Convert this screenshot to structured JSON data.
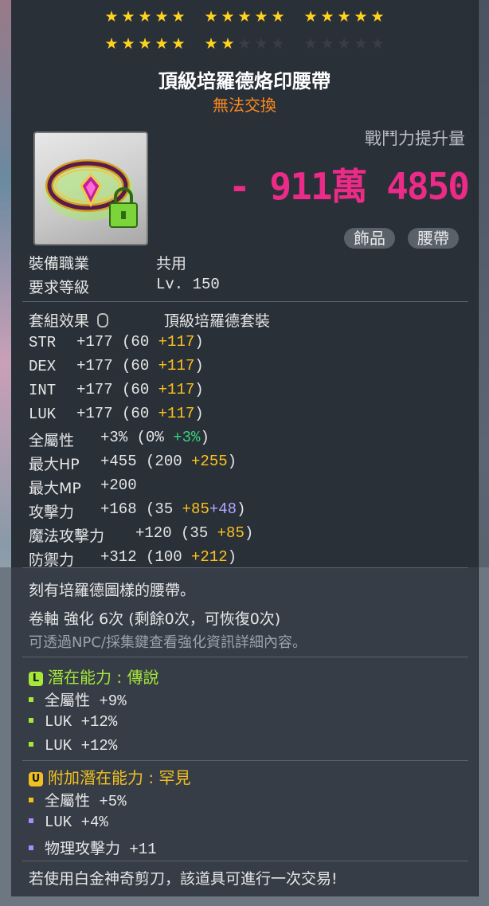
{
  "stars": {
    "row1": [
      5,
      5,
      5
    ],
    "row2": [
      5,
      2,
      0
    ],
    "per_group": 5
  },
  "item": {
    "name": "頂級培羅德烙印腰帶",
    "trade_status": "無法交換",
    "cp_label": "戰鬥力提升量",
    "cp_value": "- 911萬 4850",
    "tags": [
      "飾品",
      "腰帶"
    ]
  },
  "info": {
    "job_label": "裝備職業",
    "job_value": "共用",
    "level_label": "要求等級",
    "level_value": "Lv. 150",
    "set_label": "套組效果",
    "set_value": "頂級培羅德套裝"
  },
  "stats": [
    {
      "name": "STR",
      "total": "+177",
      "base": "(60",
      "bonus": "+117",
      "bonus2": "",
      "green": "",
      "close": ")"
    },
    {
      "name": "DEX",
      "total": "+177",
      "base": "(60",
      "bonus": "+117",
      "bonus2": "",
      "green": "",
      "close": ")"
    },
    {
      "name": "INT",
      "total": "+177",
      "base": "(60",
      "bonus": "+117",
      "bonus2": "",
      "green": "",
      "close": ")"
    },
    {
      "name": "LUK",
      "total": "+177",
      "base": "(60",
      "bonus": "+117",
      "bonus2": "",
      "green": "",
      "close": ")"
    },
    {
      "name": "全屬性",
      "total": "+3%",
      "base": "(0%",
      "bonus": "",
      "bonus2": "",
      "green": "+3%",
      "close": ")"
    },
    {
      "name": "最大HP",
      "total": "+455",
      "base": "(200",
      "bonus": "+255",
      "bonus2": "",
      "green": "",
      "close": ")"
    },
    {
      "name": "最大MP",
      "total": "+200",
      "base": "",
      "bonus": "",
      "bonus2": "",
      "green": "",
      "close": ""
    },
    {
      "name": "攻擊力",
      "total": "+168",
      "base": "(35",
      "bonus": "+85",
      "bonus2": "+48",
      "green": "",
      "close": ")"
    },
    {
      "name": "魔法攻擊力",
      "total": "+120",
      "base": "(35",
      "bonus": "+85",
      "bonus2": "",
      "green": "",
      "close": ")"
    },
    {
      "name": "防禦力",
      "total": "+312",
      "base": "(100",
      "bonus": "+212",
      "bonus2": "",
      "green": "",
      "close": ")"
    }
  ],
  "description": "刻有培羅德圖樣的腰帶。",
  "scroll": "卷軸 強化 6次 (剩餘0次，可恢復0次)",
  "hint": "可透過NPC/採集鍵查看強化資訊詳細內容。",
  "potential": {
    "badge": "L",
    "title": "潛在能力 : 傳說",
    "color": "#a6e83a",
    "lines": [
      "全屬性 +9%",
      "LUK +12%",
      "LUK +12%"
    ]
  },
  "additional": {
    "badge": "U",
    "title": "附加潛在能力 : 罕見",
    "color": "#f0c020",
    "lines": [
      {
        "text": "全屬性 +5%",
        "color": "#f0c020"
      },
      {
        "text": "LUK +4%",
        "color": "#a98cff"
      },
      {
        "text": "物理攻擊力 +11",
        "color": "#a98cff"
      }
    ]
  },
  "footer": "若使用白金神奇剪刀，該道具可進行一次交易!",
  "colors": {
    "star_on": "#ffd21e",
    "trade_orange": "#ff8a1e",
    "cp_pink": "#ec2a88",
    "stat_yellow": "#ffc21c",
    "stat_green": "#34d57a",
    "stat_blue": "#b0a8ff"
  },
  "icons": {
    "item": "belt-icon",
    "lock": "lock-icon",
    "set": "mouse-icon"
  }
}
